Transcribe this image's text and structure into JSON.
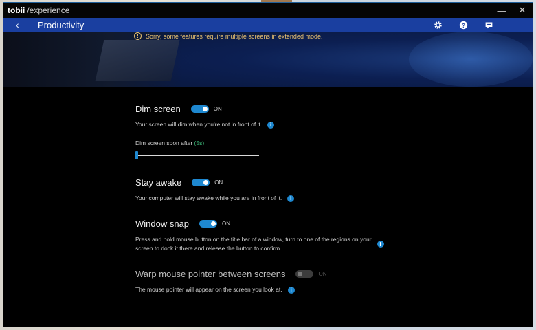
{
  "window": {
    "brand": "tobii",
    "brand_sub": "/experience",
    "minimize_glyph": "—",
    "close_glyph": "✕"
  },
  "nav": {
    "back_glyph": "‹",
    "page_title": "Productivity",
    "icons": [
      "settings-icon",
      "help-icon",
      "feedback-icon"
    ]
  },
  "notice": {
    "icon_glyph": "!",
    "text": "Sorry, some features require multiple screens in extended mode."
  },
  "settings": {
    "dim_screen": {
      "title": "Dim screen",
      "state": "ON",
      "enabled": true,
      "description": "Your screen will dim when you're not in front of it.",
      "slider_label": "Dim screen soon after",
      "slider_value": "(5s)",
      "slider_fraction": 0.0
    },
    "stay_awake": {
      "title": "Stay awake",
      "state": "ON",
      "enabled": true,
      "description": "Your computer will stay awake while you are in front of it."
    },
    "window_snap": {
      "title": "Window snap",
      "state": "ON",
      "enabled": true,
      "description_line1": "Press and hold mouse button on the title bar of a window, turn to one of the regions on your",
      "description_line2": "screen to dock it there and release the button to confirm."
    },
    "warp_mouse": {
      "title": "Warp mouse pointer between screens",
      "state": "ON",
      "enabled": false,
      "description": "The mouse pointer will appear on the screen you look at."
    }
  },
  "info_glyph": "i",
  "colors": {
    "accent": "#1e88d0",
    "nav_bar": "#1a3fa0",
    "notice": "#e8c070",
    "slider_value": "#3cb878"
  }
}
